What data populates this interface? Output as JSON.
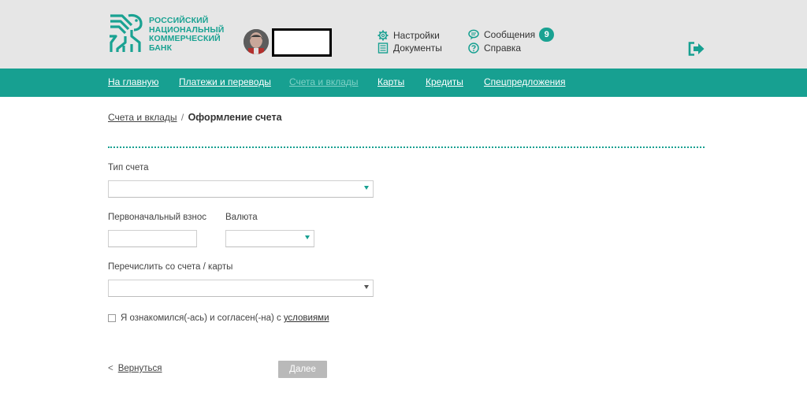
{
  "bank": {
    "logo_lines": [
      "РОССИЙСКИЙ",
      "НАЦИОНАЛЬНЫЙ",
      "КОММЕРЧЕСКИЙ",
      "БАНК"
    ]
  },
  "header": {
    "settings_label": "Настройки",
    "documents_label": "Документы",
    "messages_label": "Сообщения",
    "messages_count": "9",
    "help_label": "Справка"
  },
  "nav": {
    "items": [
      {
        "label": "На главную"
      },
      {
        "label": "Платежи и переводы"
      },
      {
        "label": "Счета и вклады"
      },
      {
        "label": "Карты"
      },
      {
        "label": "Кредиты"
      },
      {
        "label": "Спецпредложения"
      }
    ],
    "active_index": 2
  },
  "breadcrumb": {
    "parent": "Счета и вклады",
    "separator": "/",
    "current": "Оформление счета"
  },
  "form": {
    "account_type_label": "Тип счета",
    "account_type_value": "",
    "initial_deposit_label": "Первоначальный взнос",
    "initial_deposit_value": "",
    "currency_label": "Валюта",
    "currency_value": "",
    "transfer_from_label": "Перечислить со счета / карты",
    "transfer_from_value": "",
    "agreement_text": "Я ознакомился(-ась) и согласен(-на) с",
    "agreement_link": "условиями",
    "agreement_checked": false
  },
  "actions": {
    "back_symbol": "<",
    "back_label": "Вернуться",
    "next_label": "Далее"
  },
  "colors": {
    "brand": "#17a091",
    "header_bg": "#e6e6e6",
    "button_disabled": "#b9b9b9"
  }
}
